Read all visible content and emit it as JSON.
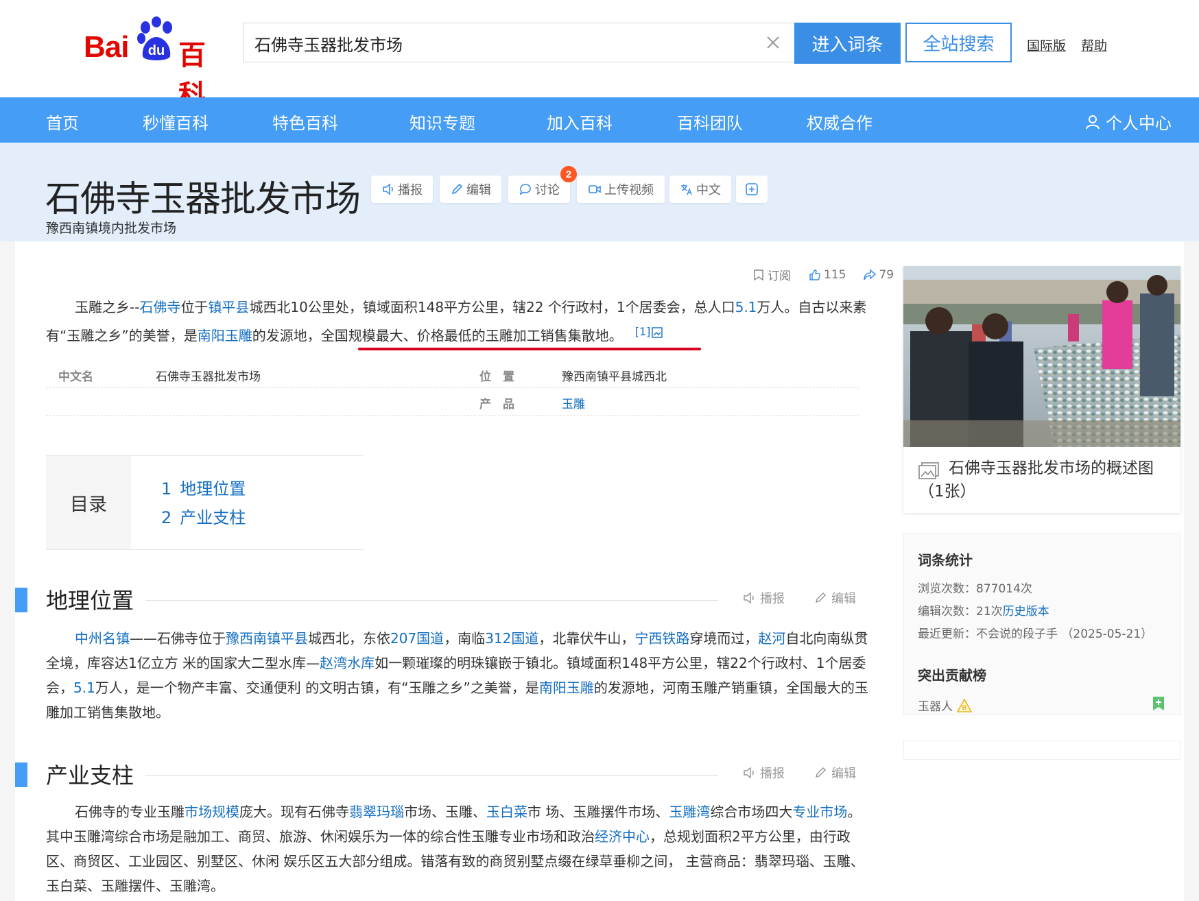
{
  "header": {
    "logo": {
      "text_bai": "Bai",
      "text_du": "du",
      "text_baike": "百科"
    },
    "search": {
      "value": "石佛寺玉器批发市场"
    },
    "enter_button": "进入词条",
    "site_search_button": "全站搜索",
    "links": [
      "国际版",
      "帮助"
    ]
  },
  "nav": {
    "items": [
      "首页",
      "秒懂百科",
      "特色百科",
      "知识专题",
      "加入百科",
      "百科团队",
      "权威合作"
    ],
    "user_center": "个人中心"
  },
  "title_band": {
    "title": "石佛寺玉器批发市场",
    "subtitle": "豫西南镇境内批发市场",
    "buttons": [
      "播报",
      "编辑",
      "讨论",
      "上传视频",
      "中文"
    ],
    "discuss_badge": "2"
  },
  "article_stats": {
    "subscribe": "订阅",
    "likes": "115",
    "shares": "79"
  },
  "summary": {
    "p1": "玉雕之乡--",
    "l1": "石佛寺",
    "p2": "位于",
    "l2": "镇平县",
    "p3": "城西北10公里处，镇域面积148平方公里，辖22 个行政村，1个居委会，总人口",
    "l3": "5.1",
    "p4": "万人。自古以来素有“玉雕之乡”的美誉，是",
    "l4": "南阳玉雕",
    "p5": "的发源地，全国规模最大、价格最低的玉雕加工销售集散地。",
    "ref": "[1]"
  },
  "infobox": {
    "k1": "中文名",
    "v1": "石佛寺玉器批发市场",
    "k2": "位　置",
    "v2": "豫西南镇平县城西北",
    "k3": "产　品",
    "v3": "玉雕"
  },
  "toc": {
    "title": "目录",
    "items": [
      {
        "num": "1",
        "label": "地理位置"
      },
      {
        "num": "2",
        "label": "产业支柱"
      }
    ]
  },
  "section1": {
    "title": "地理位置",
    "listen": "播报",
    "edit": "编辑",
    "t": [
      {
        "k": "l",
        "s": "中州名镇"
      },
      {
        "k": "p",
        "s": "——石佛寺位于"
      },
      {
        "k": "l",
        "s": "豫西南镇平县"
      },
      {
        "k": "p",
        "s": "城西北，东依"
      },
      {
        "k": "l",
        "s": "207国道"
      },
      {
        "k": "p",
        "s": "，南临"
      },
      {
        "k": "l",
        "s": "312国道"
      },
      {
        "k": "p",
        "s": "，北靠伏牛山，"
      },
      {
        "k": "l",
        "s": "宁西铁路"
      },
      {
        "k": "p",
        "s": "穿境而过，"
      },
      {
        "k": "l",
        "s": "赵河"
      },
      {
        "k": "p",
        "s": "自北向南纵贯全境，库容达1亿立方 米的国家大二型水库—"
      },
      {
        "k": "l",
        "s": "赵湾水库"
      },
      {
        "k": "p",
        "s": "如一颗璀璨的明珠镶嵌于镇北。镇域面积148平方公里，辖22个行政村、1个居委会，"
      },
      {
        "k": "l",
        "s": "5.1"
      },
      {
        "k": "p",
        "s": "万人，是一个物产丰富、交通便利 的文明古镇，有“玉雕之乡”之美誉，是"
      },
      {
        "k": "l",
        "s": "南阳玉雕"
      },
      {
        "k": "p",
        "s": "的发源地，河南玉雕产销重镇，全国最大的玉雕加工销售集散地。"
      }
    ]
  },
  "section2": {
    "title": "产业支柱",
    "listen": "播报",
    "edit": "编辑",
    "t": [
      {
        "k": "p",
        "s": "石佛寺的专业玉雕"
      },
      {
        "k": "l",
        "s": "市场规模"
      },
      {
        "k": "p",
        "s": "庞大。现有石佛寺"
      },
      {
        "k": "l",
        "s": "翡翠玛瑙"
      },
      {
        "k": "p",
        "s": "市场、玉雕、"
      },
      {
        "k": "l",
        "s": "玉白菜"
      },
      {
        "k": "p",
        "s": "市 场、玉雕摆件市场、"
      },
      {
        "k": "l",
        "s": "玉雕湾"
      },
      {
        "k": "p",
        "s": "综合市场四大"
      },
      {
        "k": "l",
        "s": "专业市场"
      },
      {
        "k": "p",
        "s": "。其中玉雕湾综合市场是融加工、商贸、旅游、休闲娱乐为一体的综合性玉雕专业市场和政治"
      },
      {
        "k": "l",
        "s": "经济中心"
      },
      {
        "k": "p",
        "s": "，总规划面积2平方公里，由行政区、商贸区、工业园区、别墅区、休闲 娱乐区五大部分组成。错落有致的商贸别墅点缀在绿草垂柳之间， 主营商品：翡翠玛瑙、玉雕、玉白菜、玉雕摆件、玉雕湾。"
      }
    ]
  },
  "sidebar": {
    "photo_caption": "石佛寺玉器批发市场的概述图（1张）",
    "stats_title": "词条统计",
    "views_label": "浏览次数：",
    "views": "877014次",
    "edits_label": "编辑次数：",
    "edits": "21次",
    "history_link": "历史版本",
    "updated_label": "最近更新：",
    "updated": "不会说的段子手 （2025-05-21）",
    "contrib_title": "突出贡献榜",
    "contributor": "玉器人"
  },
  "colors": {
    "brand_blue": "#459df5",
    "link": "#136ec2",
    "logo_red": "#e10601",
    "underline_red": "#d9001b"
  }
}
